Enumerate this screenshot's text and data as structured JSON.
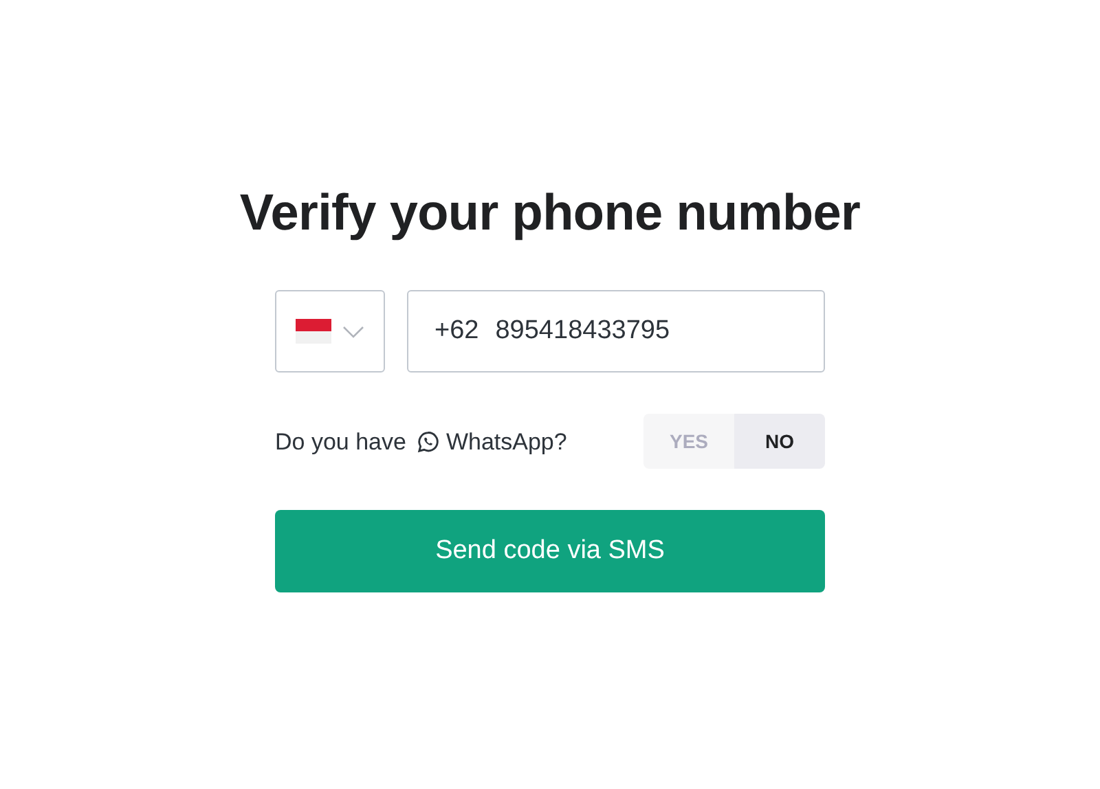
{
  "title": "Verify your phone number",
  "phone": {
    "country_prefix": "+62",
    "value": "895418433795"
  },
  "whatsapp": {
    "question_before": "Do you have",
    "question_after": "WhatsApp?",
    "options": [
      {
        "label": "YES",
        "selected": false
      },
      {
        "label": "NO",
        "selected": true
      }
    ]
  },
  "submit": {
    "label": "Send code via SMS"
  }
}
